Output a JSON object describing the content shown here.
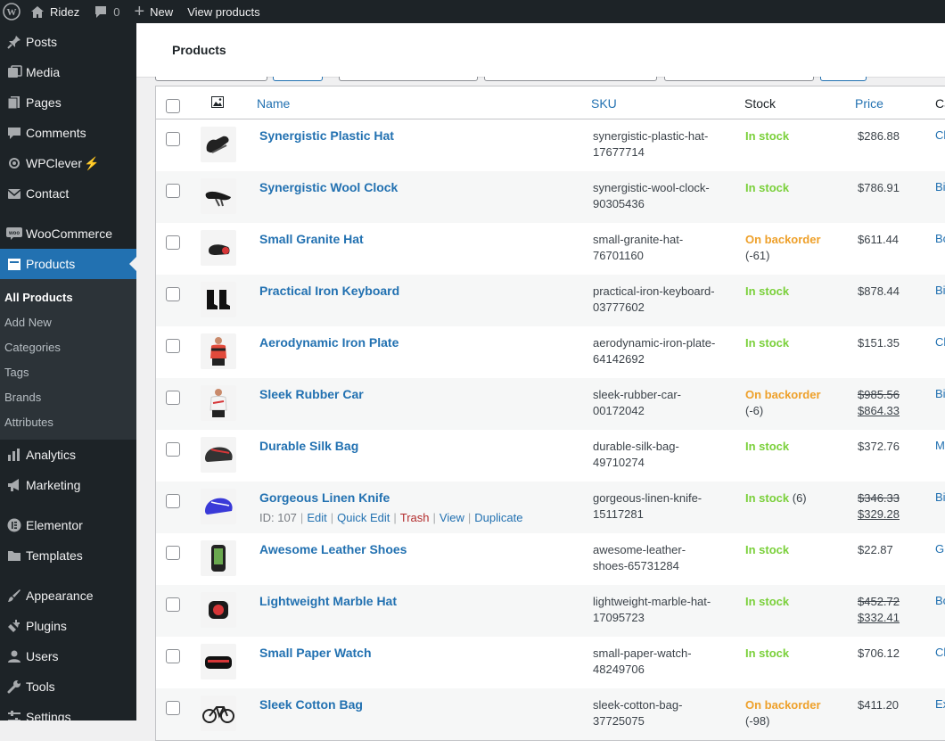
{
  "adminbar": {
    "site_name": "Ridez",
    "comments_count": "0",
    "new_label": "New",
    "view_label": "View products"
  },
  "sidebar": {
    "items": [
      {
        "label": "Posts",
        "icon": "pin-icon"
      },
      {
        "label": "Media",
        "icon": "media-icon"
      },
      {
        "label": "Pages",
        "icon": "pages-icon"
      },
      {
        "label": "Comments",
        "icon": "comment-icon"
      },
      {
        "label": "WPClever",
        "icon": "wpclever-icon",
        "suffix": "⚡"
      },
      {
        "label": "Contact",
        "icon": "mail-icon"
      },
      {
        "label": "WooCommerce",
        "icon": "woo-icon"
      },
      {
        "label": "Products",
        "icon": "products-icon"
      },
      {
        "label": "Analytics",
        "icon": "analytics-icon"
      },
      {
        "label": "Marketing",
        "icon": "megaphone-icon"
      },
      {
        "label": "Elementor",
        "icon": "elementor-icon"
      },
      {
        "label": "Templates",
        "icon": "folder-icon"
      },
      {
        "label": "Appearance",
        "icon": "brush-icon"
      },
      {
        "label": "Plugins",
        "icon": "plug-icon"
      },
      {
        "label": "Users",
        "icon": "user-icon"
      },
      {
        "label": "Tools",
        "icon": "wrench-icon"
      },
      {
        "label": "Settings",
        "icon": "settings-icon"
      }
    ],
    "submenu": [
      "All Products",
      "Add New",
      "Categories",
      "Tags",
      "Brands",
      "Attributes"
    ]
  },
  "page": {
    "title": "Products"
  },
  "table": {
    "headers": {
      "name": "Name",
      "sku": "SKU",
      "stock": "Stock",
      "price": "Price",
      "categories": "Ca"
    },
    "rows": [
      {
        "name": "Synergistic Plastic Hat",
        "sku1": "synergistic-plastic-hat-",
        "sku2": "17677714",
        "stock": "In stock",
        "stock_type": "in",
        "qty": "",
        "price": "$286.88",
        "old_price": "",
        "cat": "Cl",
        "thumb": "gloves"
      },
      {
        "name": "Synergistic Wool Clock",
        "sku1": "synergistic-wool-clock-",
        "sku2": "90305436",
        "stock": "In stock",
        "stock_type": "in",
        "qty": "",
        "price": "$786.91",
        "old_price": "",
        "cat": "Bi",
        "thumb": "saddle"
      },
      {
        "name": "Small Granite Hat",
        "sku1": "small-granite-hat-",
        "sku2": "76701160",
        "stock": "On backorder",
        "stock_type": "back",
        "qty": "(-61)",
        "price": "$611.44",
        "old_price": "",
        "cat": "Bo",
        "thumb": "light"
      },
      {
        "name": "Practical Iron Keyboard",
        "sku1": "practical-iron-keyboard-",
        "sku2": "03777602",
        "stock": "In stock",
        "stock_type": "in",
        "qty": "",
        "price": "$878.44",
        "old_price": "",
        "cat": "Bi",
        "thumb": "shoes"
      },
      {
        "name": "Aerodynamic Iron Plate",
        "sku1": "aerodynamic-iron-plate-",
        "sku2": "64142692",
        "stock": "In stock",
        "stock_type": "in",
        "qty": "",
        "price": "$151.35",
        "old_price": "",
        "cat": "Cl",
        "thumb": "jersey-red"
      },
      {
        "name": "Sleek Rubber Car",
        "sku1": "sleek-rubber-car-",
        "sku2": "00172042",
        "stock": "On backorder",
        "stock_type": "back",
        "qty": "(-6)",
        "price": "$864.33",
        "old_price": "$985.56",
        "cat": "Bi",
        "thumb": "jersey-white"
      },
      {
        "name": "Durable Silk Bag",
        "sku1": "durable-silk-bag-",
        "sku2": "49710274",
        "stock": "In stock",
        "stock_type": "in",
        "qty": "",
        "price": "$372.76",
        "old_price": "",
        "cat": "M",
        "thumb": "helmet"
      },
      {
        "name": "Gorgeous Linen Knife",
        "sku1": "gorgeous-linen-knife-",
        "sku2": "15117281",
        "stock": "In stock",
        "stock_type": "in",
        "qty": "(6)",
        "price": "$329.28",
        "old_price": "$346.33",
        "cat": "Bi",
        "thumb": "helmet-blue",
        "hover": true
      },
      {
        "name": "Awesome Leather Shoes",
        "sku1": "awesome-leather-",
        "sku2": "shoes-65731284",
        "stock": "In stock",
        "stock_type": "in",
        "qty": "",
        "price": "$22.87",
        "old_price": "",
        "cat": "Gl",
        "thumb": "gps"
      },
      {
        "name": "Lightweight Marble Hat",
        "sku1": "lightweight-marble-hat-",
        "sku2": "17095723",
        "stock": "In stock",
        "stock_type": "in",
        "qty": "",
        "price": "$332.41",
        "old_price": "$452.72",
        "cat": "Bo",
        "thumb": "light-red"
      },
      {
        "name": "Small Paper Watch",
        "sku1": "small-paper-watch-",
        "sku2": "48249706",
        "stock": "In stock",
        "stock_type": "in",
        "qty": "",
        "price": "$706.12",
        "old_price": "",
        "cat": "Cl",
        "thumb": "bag"
      },
      {
        "name": "Sleek Cotton Bag",
        "sku1": "sleek-cotton-bag-",
        "sku2": "37725075",
        "stock": "On backorder",
        "stock_type": "back",
        "qty": "(-98)",
        "price": "$411.20",
        "old_price": "",
        "cat": "Ex",
        "thumb": "bike"
      }
    ],
    "row_actions": {
      "id_text": "ID: 107",
      "edit": "Edit",
      "quick_edit": "Quick Edit",
      "trash": "Trash",
      "view": "View",
      "duplicate": "Duplicate",
      "separator": "|"
    }
  }
}
